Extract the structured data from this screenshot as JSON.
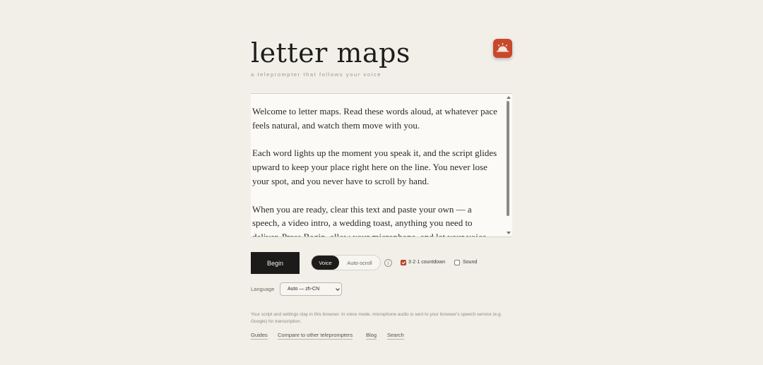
{
  "app": {
    "title": "letter maps",
    "tagline": "a teleprompter that follows your voice",
    "logo_color": "#c9482b",
    "logo_icon": "sunrise-icon"
  },
  "script": {
    "paragraphs": [
      "Welcome to letter maps. Read these words aloud, at whatever pace feels natural, and watch them move with you.",
      "Each word lights up the moment you speak it, and the script glides upward to keep your place right here on the line. You never lose your spot, and you never have to scroll by hand.",
      "When you are ready, clear this text and paste your own — a speech, a video intro, a wedding toast, anything you need to deliver. Press Begin, allow your microphone, and let your voice lead the way."
    ]
  },
  "controls": {
    "begin_label": "Begin",
    "mode_voice": "Voice",
    "mode_autoscroll": "Auto-scroll",
    "mode_selected": "Voice",
    "info_glyph": "i",
    "countdown_label": "3·2·1 countdown",
    "countdown_checked": true,
    "sound_label": "Sound",
    "sound_checked": false,
    "language_label": "Language",
    "language_value": "Auto — zh-CN"
  },
  "privacy_note": "Your script and settings stay in this browser. In voice mode, microphone audio is sent to your browser's speech service (e.g. Google) for transcription.",
  "footer_links": [
    "Guides",
    "Compare to other teleprompters",
    "Blog",
    "Search"
  ],
  "colors": {
    "background": "#f2efe9",
    "accent": "#c9482b",
    "dark": "#1c1b19"
  }
}
